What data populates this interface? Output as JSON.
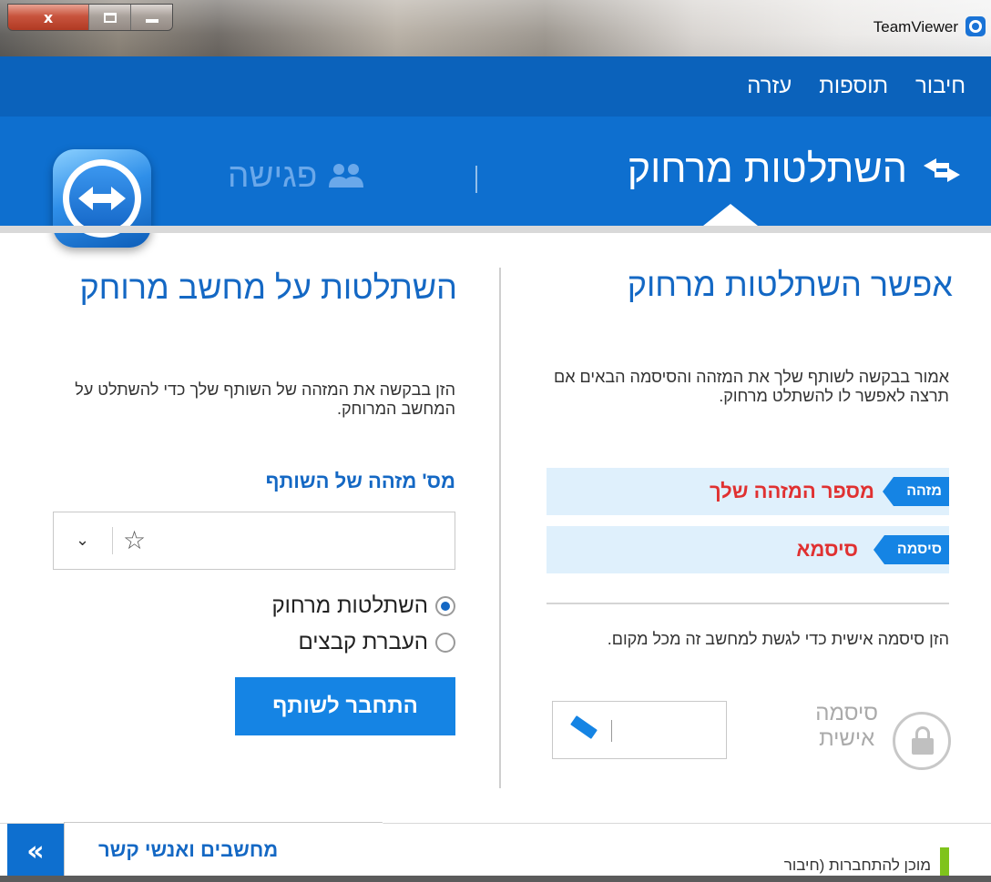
{
  "window": {
    "title": "TeamViewer",
    "controls": {
      "close": "x"
    }
  },
  "menu": {
    "items": [
      "חיבור",
      "תוספות",
      "עזרה"
    ]
  },
  "tabs": {
    "remote_control": "השתלטות מרחוק",
    "meeting": "פגישה"
  },
  "allow_remote": {
    "heading": "אפשר השתלטות מרחוק",
    "description": "אמור בבקשה לשותף שלך את המזהה והסיסמה הבאים אם תרצה לאפשר לו להשתלט מרחוק.",
    "id_label": "מזהה",
    "id_value": "מספר המזהה שלך",
    "password_label": "סיסמה",
    "password_value": "סיסמא",
    "personal_description": "הזן סיסמה אישית כדי לגשת למחשב זה מכל מקום.",
    "personal_password_label_line1": "סיסמה",
    "personal_password_label_line2": "אישית"
  },
  "control_remote": {
    "heading": "השתלטות על מחשב מרוחק",
    "description": "הזן בבקשה את המזהה של השותף שלך כדי להשתלט על המחשב המרוחק.",
    "partner_id_label": "מס' מזהה של השותף",
    "partner_id_value": "",
    "options": [
      {
        "label": "השתלטות מרחוק",
        "selected": true
      },
      {
        "label": "העברת קבצים",
        "selected": false
      }
    ],
    "connect_button": "התחבר לשותף"
  },
  "bottom": {
    "contacts_tab": "מחשבים ואנשי קשר",
    "expand_icon": "«",
    "status_text": "מוכן להתחברות (חיבור",
    "status_color": "#7fc31c"
  },
  "colors": {
    "brand_blue": "#0e6fcf",
    "accent_blue": "#1584e4",
    "credential_red": "#e03131"
  }
}
